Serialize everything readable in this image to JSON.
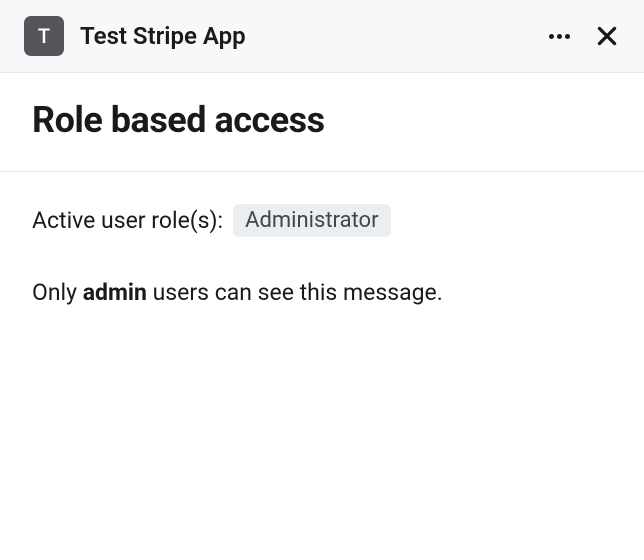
{
  "header": {
    "app_icon_letter": "T",
    "app_title": "Test Stripe App"
  },
  "title_section": {
    "page_title": "Role based access"
  },
  "content": {
    "role_label": "Active user role(s):",
    "role_badge": "Administrator",
    "message_prefix": "Only ",
    "message_bold": "admin",
    "message_suffix": " users can see this message."
  }
}
